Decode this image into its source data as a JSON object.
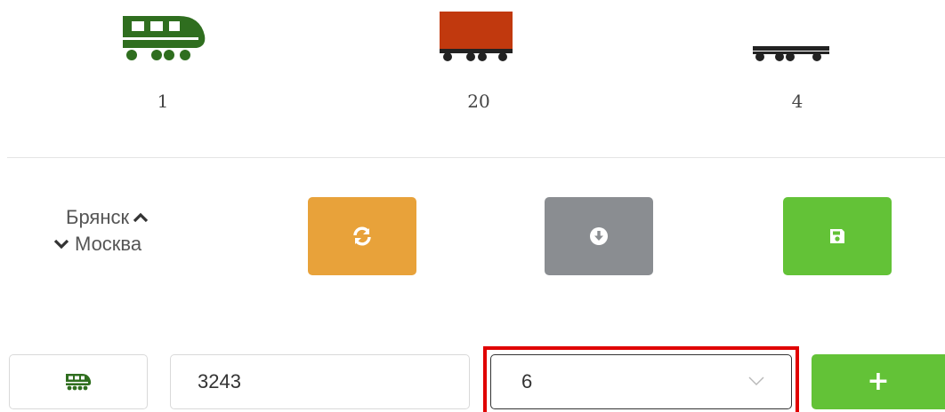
{
  "counters": {
    "locomotive": {
      "icon": "locomotive-icon",
      "count": "1",
      "color": "#2f6e1f"
    },
    "wagon": {
      "icon": "wagon-icon",
      "count": "20",
      "color": "#c1390e"
    },
    "platform": {
      "icon": "platform-icon",
      "count": "4",
      "color": "#222222"
    }
  },
  "route": {
    "from": "Брянск",
    "to": "Москва"
  },
  "actions": {
    "refresh": {
      "icon": "refresh-icon",
      "color": "#e8a23a"
    },
    "download": {
      "icon": "download-icon",
      "color": "#8a8d91"
    },
    "save": {
      "icon": "save-icon",
      "color": "#63c237"
    }
  },
  "form": {
    "vehicle_type_icon": "locomotive-icon",
    "number_value": "3243",
    "count_value": "6",
    "add_label": "+",
    "add_color": "#63c237",
    "highlight_color": "#e00000"
  }
}
